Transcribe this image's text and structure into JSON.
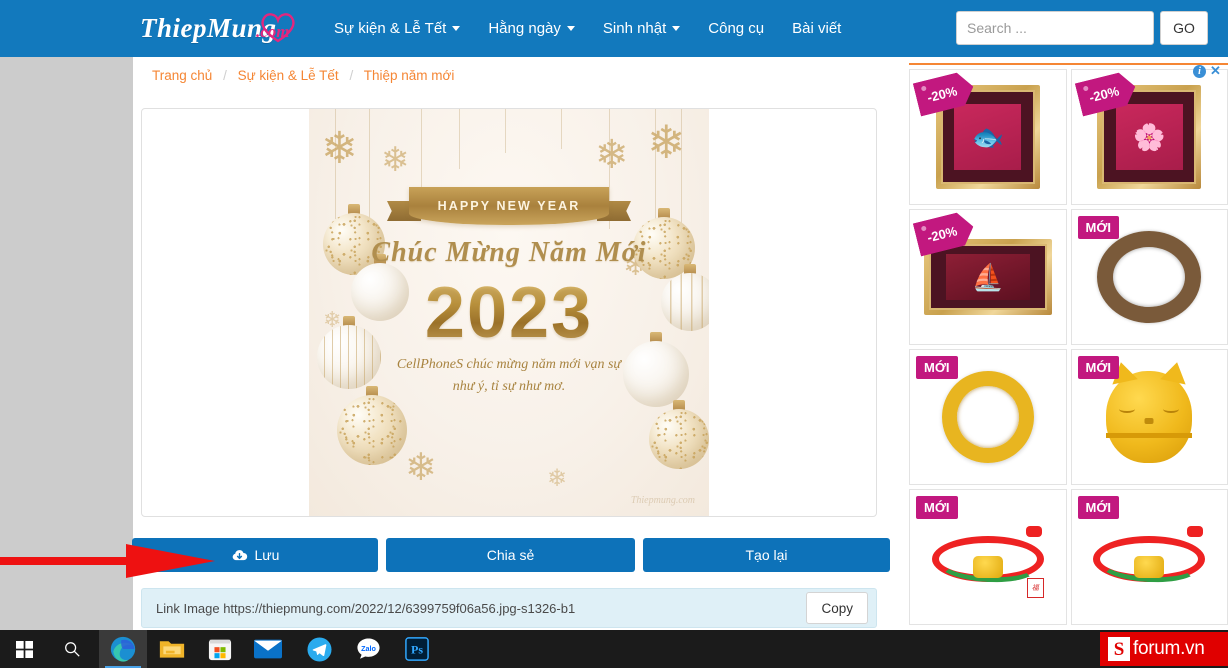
{
  "navbar": {
    "brand_main": "ThiepMung",
    "brand_suffix": ".com",
    "brand_icon": "heart-icon",
    "menu": [
      {
        "label": "Sự kiện & Lễ Tết",
        "has_caret": true
      },
      {
        "label": "Hằng ngày",
        "has_caret": true
      },
      {
        "label": "Sinh nhật",
        "has_caret": true
      },
      {
        "label": "Công cụ",
        "has_caret": false
      },
      {
        "label": "Bài viết",
        "has_caret": false
      }
    ],
    "search": {
      "value": "",
      "placeholder": "Search ...",
      "go_label": "GO"
    },
    "bg_color": "#1279bd"
  },
  "breadcrumb": {
    "items": [
      "Trang chủ",
      "Sự kiện & Lễ Tết",
      "Thiệp năm mới"
    ],
    "separator": "/",
    "link_color": "#f58634"
  },
  "card": {
    "ribbon_text": "HAPPY NEW YEAR",
    "script_text": "Chúc Mừng Năm Mới",
    "year": "2023",
    "wish_line1": "CellPhoneS chúc mừng năm mới vạn sự",
    "wish_line2": "như ý, tỉ sự như mơ.",
    "watermark": "Thiepmung.com"
  },
  "actions": {
    "save_label": "Lưu",
    "save_icon": "download-cloud-icon",
    "share_label": "Chia sẻ",
    "recreate_label": "Tạo lại",
    "button_color": "#0d72b9"
  },
  "link_bar": {
    "text": "Link Image https://thiepmung.com/2022/12/6399759f06a56.jpg-s1326-b1",
    "copy_label": "Copy"
  },
  "ads": {
    "info_icon": "info-icon",
    "close_icon": "close-icon",
    "items": [
      {
        "badge": "-20%",
        "badge_style": "tag",
        "art": "frame-fish"
      },
      {
        "badge": "-20%",
        "badge_style": "tag",
        "art": "frame-lotus"
      },
      {
        "badge": "-20%",
        "badge_style": "tag",
        "art": "frame-ship"
      },
      {
        "badge": "MỚI",
        "badge_style": "sq",
        "art": "bead-bracelet"
      },
      {
        "badge": "MỚI",
        "badge_style": "sq",
        "art": "gold-coin-ring"
      },
      {
        "badge": "MỚI",
        "badge_style": "sq",
        "art": "gold-cat"
      },
      {
        "badge": "MỚI",
        "badge_style": "sq",
        "art": "red-string-pixiu"
      },
      {
        "badge": "MỚI",
        "badge_style": "sq",
        "art": "red-string-rabbit"
      }
    ]
  },
  "annotation": {
    "arrow": "red-arrow-pointing-to-save-button",
    "color": "#ee1111"
  },
  "taskbar": {
    "items": [
      {
        "name": "start-button",
        "icon": "windows-logo-icon"
      },
      {
        "name": "search-button",
        "icon": "search-icon"
      },
      {
        "name": "edge-button",
        "icon": "edge-icon"
      },
      {
        "name": "file-explorer-button",
        "icon": "folder-icon"
      },
      {
        "name": "microsoft-store-button",
        "icon": "store-icon"
      },
      {
        "name": "mail-button",
        "icon": "mail-icon"
      },
      {
        "name": "telegram-button",
        "icon": "telegram-icon"
      },
      {
        "name": "zalo-button",
        "icon": "zalo-icon",
        "label": "Zalo"
      },
      {
        "name": "photoshop-button",
        "icon": "photoshop-icon",
        "label": "Ps"
      }
    ]
  },
  "watermark": {
    "mark": "S",
    "text": "forum.vn",
    "color": "#e00000"
  }
}
